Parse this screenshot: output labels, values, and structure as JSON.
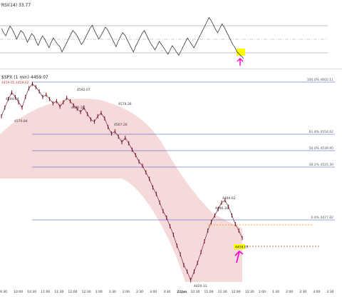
{
  "rsi_panel": {
    "label": "RSI(14) 33.77",
    "series": [
      62,
      58,
      55,
      60,
      64,
      61,
      57,
      52,
      56,
      60,
      58,
      54,
      49,
      53,
      57,
      55,
      50,
      46,
      51,
      55,
      52,
      48,
      44,
      49,
      53,
      50,
      47,
      45,
      40,
      44,
      48,
      52,
      56,
      60,
      58,
      55,
      51,
      47,
      50,
      54,
      58,
      62,
      65,
      60,
      56,
      52,
      55,
      59,
      63,
      61,
      57,
      53,
      49,
      45,
      50,
      54,
      58,
      56,
      52,
      48,
      44,
      40,
      45,
      49,
      53,
      57,
      60,
      56,
      52,
      48,
      45,
      42,
      46,
      50,
      47,
      44,
      41,
      38,
      42,
      46,
      43,
      40,
      37,
      41,
      45,
      49,
      53,
      50,
      47,
      44,
      48,
      52,
      56,
      60,
      64,
      68,
      72,
      69,
      65,
      61,
      58,
      62,
      66,
      63,
      59,
      55,
      51,
      47,
      44,
      40,
      38,
      36,
      34
    ]
  },
  "price_panel": {
    "label": "$SPX (1 min) 4459.07",
    "sublabel": "4459.05 4459.02",
    "price_labels": [
      {
        "text": "4594.64"
      },
      {
        "text": "4570.84"
      },
      {
        "text": "4592.07"
      },
      {
        "text": "4581.30"
      },
      {
        "text": "4579.36"
      },
      {
        "text": "4567.26"
      },
      {
        "text": "4494.62"
      },
      {
        "text": "4486.30"
      },
      {
        "text": "4420.31"
      },
      {
        "text": "4459.07"
      }
    ],
    "fib_labels": [
      {
        "text": "100.0% 4602.11"
      },
      {
        "text": "61.8% 4554.62"
      },
      {
        "text": "50.0% 4539.95"
      },
      {
        "text": "38.2% 4525.30"
      },
      {
        "text": "0.0% 4477.82"
      }
    ],
    "time_labels": [
      "9:30",
      "10:00",
      "10:30",
      "11:00",
      "11:30",
      "12:00",
      "12:30",
      "1:00",
      "1:30",
      "2:00",
      "2:30",
      "3:00",
      "3:30",
      "21Jan",
      "10:30",
      "11:00",
      "11:30",
      "12:00",
      "12:30",
      "1:00",
      "1:30",
      "2:00",
      "2:30",
      "3:00",
      "3:30"
    ],
    "series": [
      4572,
      4580,
      4588,
      4594,
      4590,
      4585,
      4580,
      4590,
      4598,
      4602,
      4599,
      4595,
      4590,
      4592,
      4588,
      4584,
      4586,
      4581,
      4585,
      4589,
      4586,
      4582,
      4579,
      4576,
      4580,
      4574,
      4569,
      4567,
      4572,
      4575,
      4570,
      4562,
      4556,
      4558,
      4553,
      4548,
      4552,
      4547,
      4541,
      4536,
      4530,
      4526,
      4520,
      4514,
      4506,
      4500,
      4492,
      4484,
      4478,
      4470,
      4462,
      4452,
      4444,
      4434,
      4428,
      4420,
      4428,
      4436,
      4446,
      4456,
      4466,
      4474,
      4480,
      4486,
      4492,
      4494,
      4488,
      4480,
      4472,
      4466,
      4459
    ]
  },
  "colors": {
    "fib_line": "#3344cc",
    "band": "#f2c9c9",
    "candles": "#7a1020",
    "marker": "#ff00cc",
    "highlight": "#ffff00",
    "orange": "#ff8800",
    "red": "#ee3333"
  }
}
